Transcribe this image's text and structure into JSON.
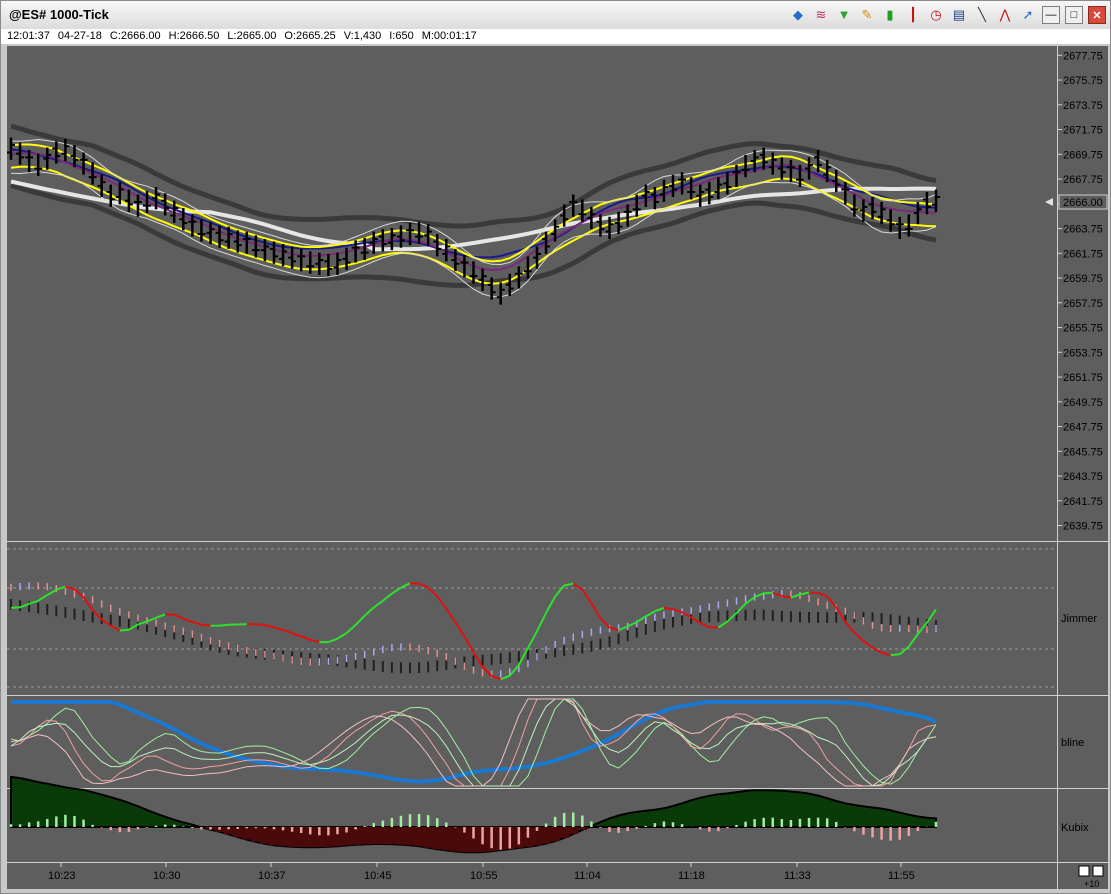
{
  "window": {
    "title": "@ES# 1000-Tick",
    "toolbar_icons": [
      "layers-icon",
      "rainbow-icon",
      "funnel-icon",
      "pencil-icon",
      "bar-chart-icon",
      "candlestick-icon",
      "clock-icon",
      "note-icon",
      "line-tool-icon",
      "zigzag-icon",
      "pointer-icon"
    ],
    "minimize": "—",
    "maximize": "□",
    "close": "✕"
  },
  "info": {
    "time": "12:01:37",
    "date": "04-27-18",
    "close": "C:2666.00",
    "high": "H:2666.50",
    "low": "L:2665.00",
    "open": "O:2665.25",
    "volume": "V:1,430",
    "interest": "I:650",
    "elapsed": "M:00:01:17"
  },
  "colors": {
    "plot_bg": "#5e5e5e",
    "axis_bg": "#5e5e5e",
    "price_bars": "#000000",
    "ma_white": "#e6e6e6",
    "ma_yellow": "#ffff00",
    "ma_blue": "#1a1a8a",
    "ma_purple": "#7a2a7a",
    "band": "#3a3a3a",
    "green": "#2ee02e",
    "red": "#e01010",
    "lavender": "#a8a8f0",
    "pink": "#e09090",
    "bline_blue": "#1a78d0",
    "kubix_green": "#0a3a0a",
    "kubix_red": "#4a0a0a",
    "hist_green": "#a0f0a0",
    "hist_red": "#f0a0a0"
  },
  "chart_data": {
    "type": "line",
    "title": "@ES# 1000-Tick",
    "price_axis": {
      "ylim": [
        2638.5,
        2678.5
      ],
      "ticks": [
        "2677.75",
        "2675.75",
        "2673.75",
        "2671.75",
        "2669.75",
        "2667.75",
        "2665.75",
        "2663.75",
        "2661.75",
        "2659.75",
        "2657.75",
        "2655.75",
        "2653.75",
        "2651.75",
        "2649.75",
        "2647.75",
        "2645.75",
        "2643.75",
        "2641.75",
        "2639.75"
      ],
      "last_price": "2666.00"
    },
    "time_axis": {
      "labels": [
        "10:23",
        "10:30",
        "10:37",
        "10:45",
        "10:55",
        "11:04",
        "11:18",
        "11:33",
        "11:55"
      ]
    },
    "price_bars": [
      2670.2,
      2669.8,
      2669.2,
      2668.9,
      2669.4,
      2669.9,
      2670.1,
      2669.6,
      2669.0,
      2668.2,
      2667.2,
      2666.4,
      2666.6,
      2666.0,
      2665.6,
      2665.9,
      2666.2,
      2665.7,
      2665.1,
      2664.5,
      2664.0,
      2663.6,
      2663.4,
      2663.1,
      2663.0,
      2662.7,
      2662.6,
      2662.3,
      2662.0,
      2661.8,
      2661.6,
      2661.4,
      2661.2,
      2661.0,
      2660.9,
      2660.8,
      2660.9,
      2661.3,
      2661.9,
      2662.1,
      2662.6,
      2662.8,
      2662.9,
      2663.1,
      2663.3,
      2663.4,
      2663.2,
      2662.4,
      2662.0,
      2661.2,
      2660.7,
      2660.2,
      2659.6,
      2658.9,
      2658.5,
      2659.2,
      2659.8,
      2660.6,
      2661.4,
      2662.6,
      2663.6,
      2664.8,
      2665.6,
      2665.2,
      2664.6,
      2664.0,
      2663.8,
      2664.2,
      2664.8,
      2665.6,
      2666.4,
      2666.2,
      2666.8,
      2667.2,
      2667.4,
      2667.0,
      2666.4,
      2666.6,
      2667.0,
      2667.4,
      2668.0,
      2668.8,
      2669.2,
      2669.4,
      2669.0,
      2668.6,
      2668.4,
      2668.0,
      2668.6,
      2669.2,
      2668.4,
      2667.6,
      2666.6,
      2665.6,
      2665.2,
      2665.4,
      2665.0,
      2664.4,
      2663.8,
      2664.0,
      2665.0,
      2665.8,
      2666.0
    ],
    "indicators": [
      {
        "name": "Jimmer"
      },
      {
        "name": "bline"
      },
      {
        "name": "Kubix"
      }
    ]
  },
  "footer": {
    "zoom_label": "+10"
  }
}
